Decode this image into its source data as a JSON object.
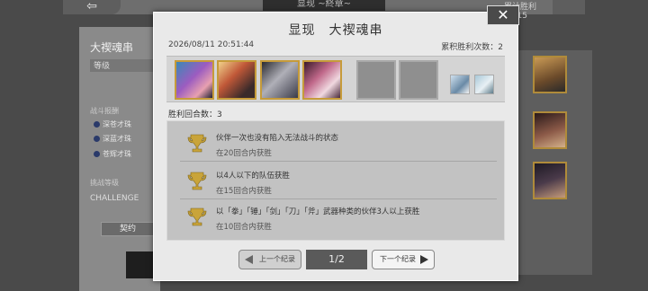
{
  "background": {
    "back_glyph": "⇦",
    "top_title": "显现 ~終章~",
    "top_right": "累计胜利 15/15",
    "name": "大禊魂串",
    "level_label": "等级",
    "section1": "战斗报酬",
    "items": [
      "深苍才珠",
      "深蓝才珠",
      "苍辉才珠"
    ],
    "section2": "挑战等级",
    "challenge": "CHALLENGE",
    "button": "契约"
  },
  "dialog": {
    "title": "显现　大禊魂串",
    "close_glyph": "✕",
    "date": "2026/08/11 20:51:44",
    "wins_label": "累积胜利次数：",
    "wins_value": "2",
    "rounds_label": "胜利回合数：",
    "rounds_value": "3",
    "conditions": [
      {
        "main": "伙伴一次也没有陷入无法战斗的状态",
        "sub": "在20回合内获胜"
      },
      {
        "main": "以4人以下的队伍获胜",
        "sub": "在15回合内获胜"
      },
      {
        "main": "以「拳」「锤」「剑」「刀」「斧」武器种类的伙伴3人以上获胜",
        "sub": "在10回合内获胜"
      }
    ],
    "prev_label": "上一个纪录",
    "page": "1/2",
    "next_label": "下一个纪录"
  },
  "colors": {
    "trophy_gold": "#c9a43a",
    "frame_gold": "#c69b3a",
    "dialog_bg": "#e9e9e9"
  }
}
